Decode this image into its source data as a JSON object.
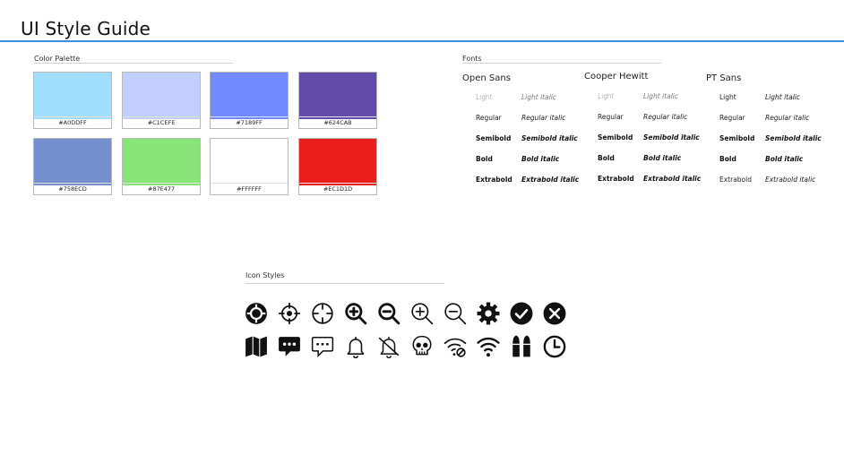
{
  "page": {
    "title": "UI Style Guide"
  },
  "palette": {
    "label": "Color Palette",
    "colors": [
      {
        "hex_label": "#A0DDFF",
        "color": "#A0DDFF"
      },
      {
        "hex_label": "#C1CEFE",
        "color": "#C1CEFE"
      },
      {
        "hex_label": "#7189FF",
        "color": "#7189FF"
      },
      {
        "hex_label": "#624CAB",
        "color": "#624CAB"
      },
      {
        "hex_label": "#758ECD",
        "color": "#758ECD"
      },
      {
        "hex_label": "#87E477",
        "color": "#87E477"
      },
      {
        "hex_label": "#FFFFFF",
        "color": "#FFFFFF"
      },
      {
        "hex_label": "#EC1D1D",
        "color": "#EC1D1D"
      }
    ]
  },
  "fonts": {
    "label": "Fonts",
    "families": [
      {
        "name": "Open Sans",
        "rows": [
          {
            "upright": "Light",
            "italic": "Light italic"
          },
          {
            "upright": "Regular",
            "italic": "Regular italic"
          },
          {
            "upright": "Semibold",
            "italic": "Semibold italic"
          },
          {
            "upright": "Bold",
            "italic": "Bold italic"
          },
          {
            "upright": "Extrabold",
            "italic": "Extrabold italic"
          }
        ]
      },
      {
        "name": "Cooper Hewitt",
        "rows": [
          {
            "upright": "Light",
            "italic": "Light italic"
          },
          {
            "upright": "Regular",
            "italic": "Regular italic"
          },
          {
            "upright": "Semibold",
            "italic": "Semibold italic"
          },
          {
            "upright": "Bold",
            "italic": "Bold italic"
          },
          {
            "upright": "Extrabold",
            "italic": "Extrabold italic"
          }
        ]
      },
      {
        "name": "PT Sans",
        "rows": [
          {
            "upright": "Light",
            "italic": "Light italic"
          },
          {
            "upright": "Regular",
            "italic": "Regular italic"
          },
          {
            "upright": "Semibold",
            "italic": "Semibold italic"
          },
          {
            "upright": "Bold",
            "italic": "Bold italic"
          },
          {
            "upright": "Extrabold",
            "italic": "Extrabold italic"
          }
        ]
      }
    ]
  },
  "icons": {
    "label": "Icon Styles",
    "row1": [
      "crosshair-filled-icon",
      "crosshair-dot-icon",
      "crosshair-outline-icon",
      "zoom-in-bold-icon",
      "zoom-out-bold-icon",
      "zoom-in-outline-icon",
      "zoom-out-outline-icon",
      "gear-icon",
      "check-circle-icon",
      "close-circle-icon"
    ],
    "row2": [
      "map-icon",
      "chat-filled-icon",
      "chat-outline-icon",
      "bell-icon",
      "bell-off-icon",
      "skull-icon",
      "wifi-off-icon",
      "wifi-icon",
      "ammo-icon",
      "clock-icon"
    ]
  }
}
